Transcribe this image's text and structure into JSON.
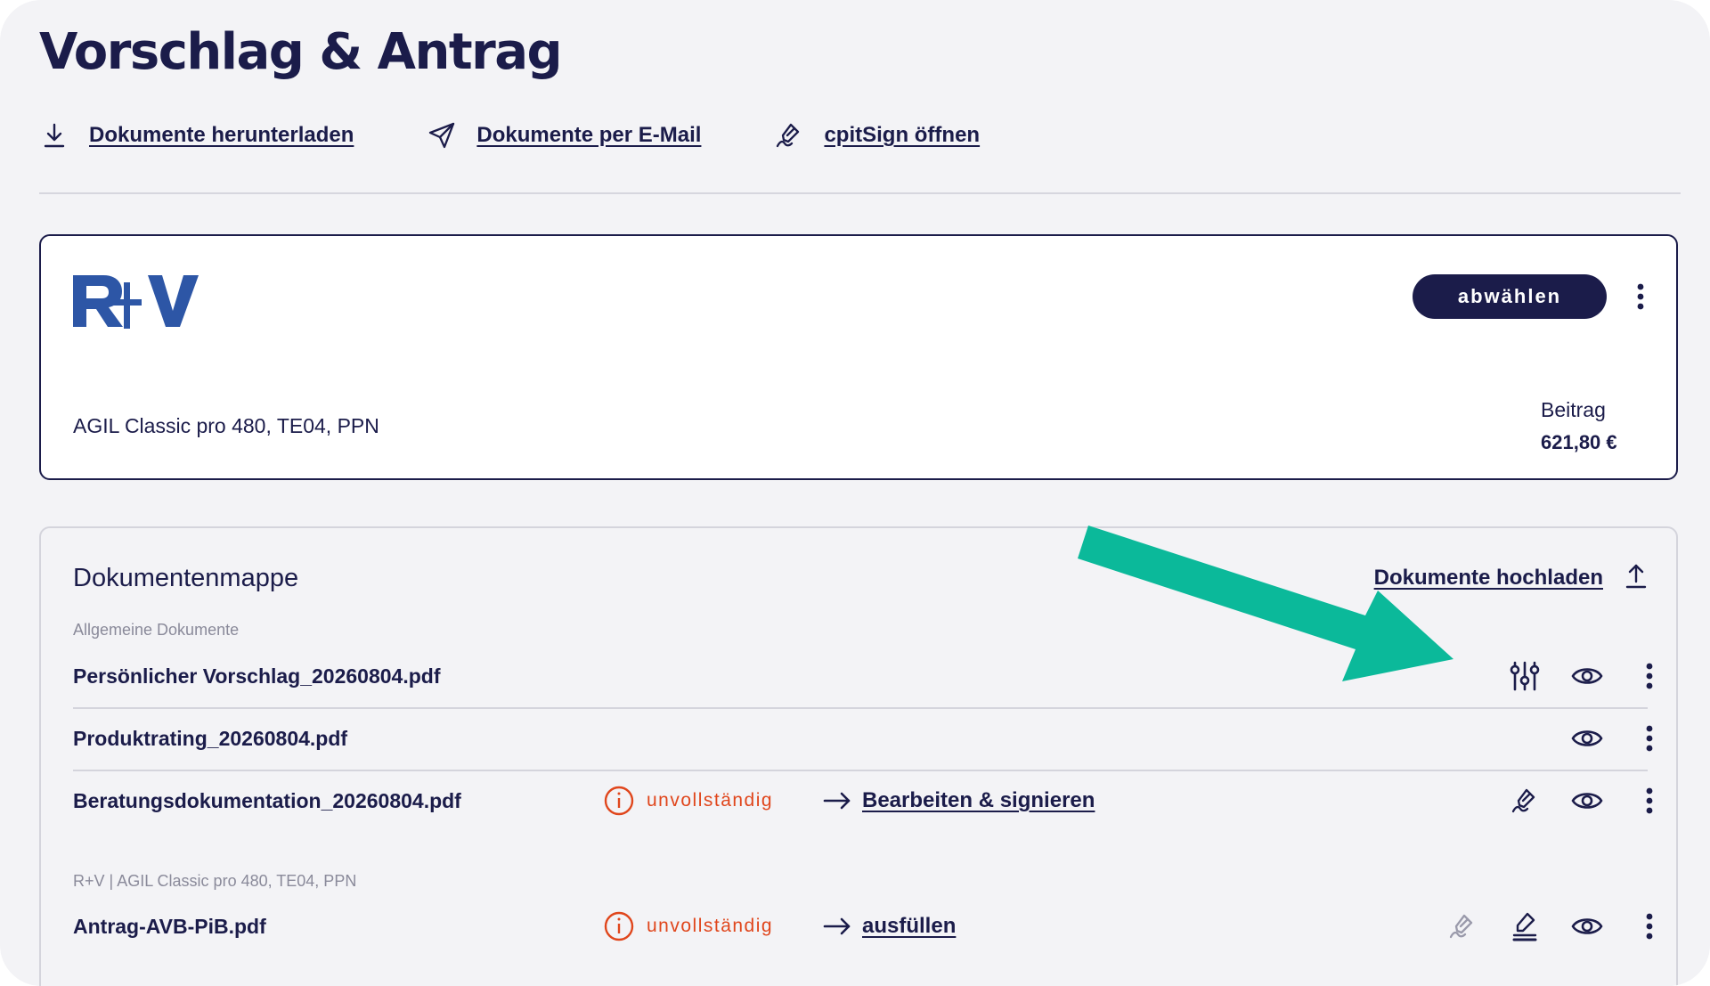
{
  "page": {
    "title": "Vorschlag & Antrag"
  },
  "actions": [
    {
      "label": "Dokumente herunterladen",
      "icon": "download-icon"
    },
    {
      "label": "Dokumente per E-Mail",
      "icon": "send-icon"
    },
    {
      "label": "cpitSign öffnen",
      "icon": "sign-pen-icon"
    }
  ],
  "offer": {
    "logo_text": "R+V",
    "deselect_label": "abwählen",
    "product": "AGIL Classic pro 480, TE04, PPN",
    "premium_label": "Beitrag",
    "premium_value": "621,80 €"
  },
  "docs": {
    "title": "Dokumentenmappe",
    "upload_label": "Dokumente hochladen",
    "groups": [
      {
        "label": "Allgemeine Dokumente",
        "files": [
          {
            "name": "Persönlicher Vorschlag_20260804.pdf"
          },
          {
            "name": "Produktrating_20260804.pdf"
          },
          {
            "name": "Beratungsdokumentation_20260804.pdf",
            "status": "unvollständig",
            "action": "Bearbeiten & signieren"
          }
        ]
      },
      {
        "label": "R+V | AGIL Classic pro 480, TE04, PPN",
        "files": [
          {
            "name": "Antrag-AVB-PiB.pdf",
            "status": "unvollständig",
            "action": "ausfüllen"
          }
        ]
      }
    ]
  },
  "colors": {
    "primary": "#1b1c4a",
    "background": "#f3f3f6",
    "warning": "#e0461c",
    "brand_logo": "#2d56a6",
    "callout_arrow": "#0bb99a",
    "disabled_icon": "#9a9aab"
  }
}
